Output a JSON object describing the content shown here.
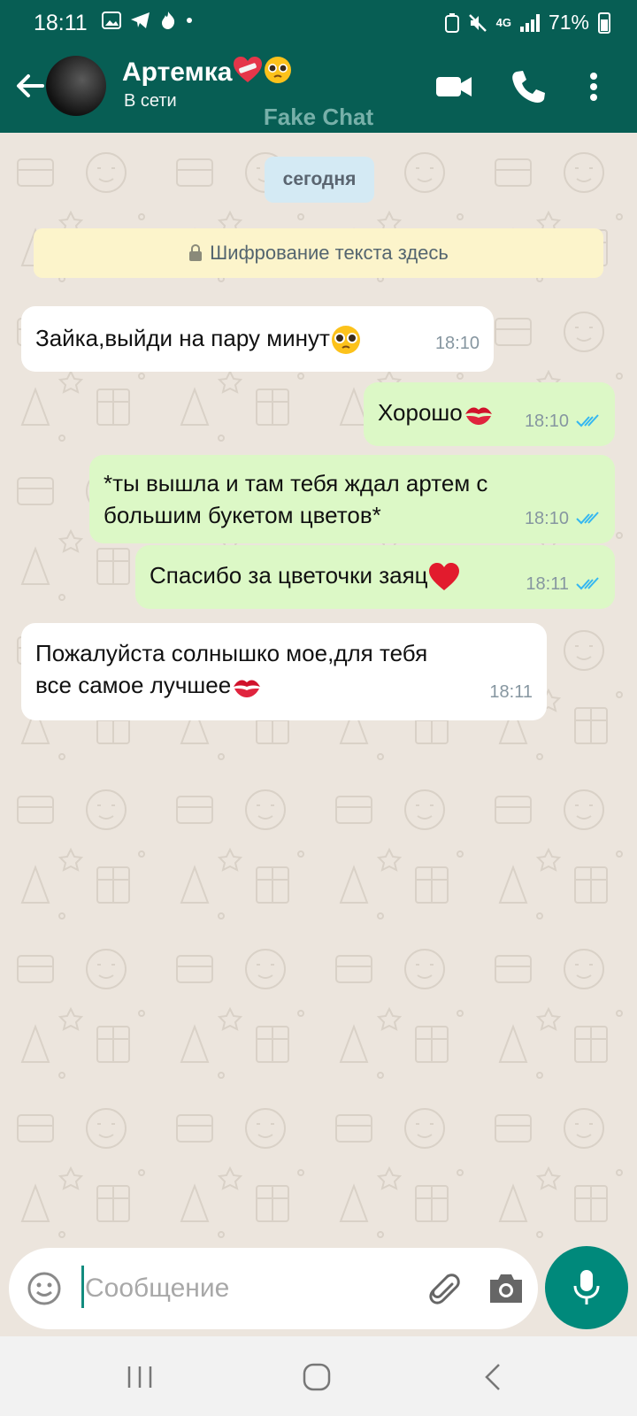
{
  "status_bar": {
    "time": "18:11",
    "battery": "71%",
    "network": "4G"
  },
  "header": {
    "contact_name": "Артемка",
    "contact_status": "В сети",
    "watermark": "Fake Chat"
  },
  "chat": {
    "date_label": "сегодня",
    "encryption_notice": "Шифрование текста здесь",
    "messages": [
      {
        "direction": "in",
        "text": "Зайка,выйди на пару минут",
        "emoji": "pleading-face",
        "time": "18:10"
      },
      {
        "direction": "out",
        "text": "Хорошо",
        "emoji": "kiss-mark",
        "time": "18:10",
        "read": true
      },
      {
        "direction": "out",
        "text_line1": "*ты вышла и там тебя ждал артем с",
        "text_line2": "большим букетом цветов*",
        "time": "18:10",
        "read": true
      },
      {
        "direction": "out",
        "text": "Спасибо за цветочки заяц",
        "emoji": "red-heart",
        "time": "18:11",
        "read": true
      },
      {
        "direction": "in",
        "text_line1": "Пожалуйста солнышко мое,для тебя",
        "text_line2": "все самое лучшее",
        "emoji": "kiss-mark",
        "time": "18:11"
      }
    ]
  },
  "composer": {
    "placeholder": "Сообщение"
  },
  "colors": {
    "header": "#075e54",
    "outgoing_bubble": "#dcf8c6",
    "incoming_bubble": "#ffffff",
    "chat_background": "#ece5dd",
    "mic_button": "#00897b",
    "read_ticks": "#34b7f1"
  }
}
